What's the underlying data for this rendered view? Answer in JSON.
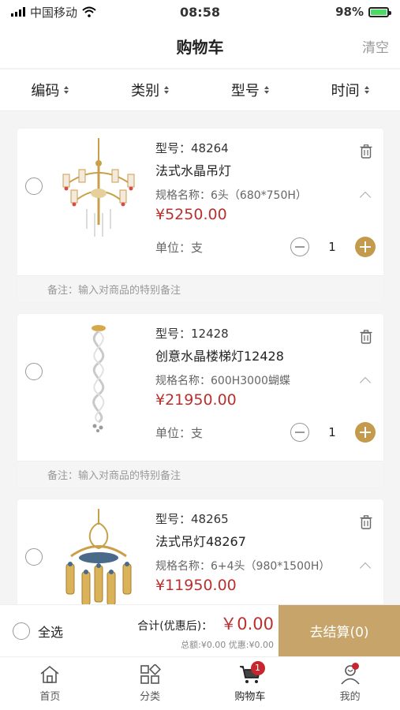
{
  "status_bar": {
    "carrier": "中国移动",
    "time": "08:58",
    "battery": "98%"
  },
  "header": {
    "title": "购物车",
    "clear_label": "清空"
  },
  "sort_bar": {
    "items": [
      {
        "label": "编码"
      },
      {
        "label": "类别"
      },
      {
        "label": "型号"
      },
      {
        "label": "时间"
      }
    ]
  },
  "cart": {
    "items": [
      {
        "model": "型号：48264",
        "name": "法式水晶吊灯",
        "spec": "规格名称：6头（680*750H）",
        "price": "¥5250.00",
        "unit": "单位：支",
        "quantity": "1",
        "remark_placeholder": "备注：输入对商品的特别备注"
      },
      {
        "model": "型号：12428",
        "name": "创意水晶楼梯灯12428",
        "spec": "规格名称：600H3000蝴蝶",
        "price": "¥21950.00",
        "unit": "单位：支",
        "quantity": "1",
        "remark_placeholder": "备注：输入对商品的特别备注"
      },
      {
        "model": "型号：48265",
        "name": "法式吊灯48267",
        "spec": "规格名称：6+4头（980*1500H）",
        "price": "¥11950.00"
      }
    ]
  },
  "checkout": {
    "select_all": "全选",
    "total_label": "合计(优惠后)：",
    "total_value": "￥0.00",
    "sub_totals": "总额:¥0.00 优惠:¥0.00",
    "submit_label": "去结算(0)"
  },
  "tab_bar": {
    "items": [
      {
        "label": "首页",
        "icon": "home-icon"
      },
      {
        "label": "分类",
        "icon": "category-icon"
      },
      {
        "label": "购物车",
        "icon": "cart-icon",
        "badge": "1"
      },
      {
        "label": "我的",
        "icon": "profile-icon"
      }
    ]
  },
  "colors": {
    "price": "#b8312f",
    "accent": "#c7a46a",
    "badge": "#c6262e"
  }
}
